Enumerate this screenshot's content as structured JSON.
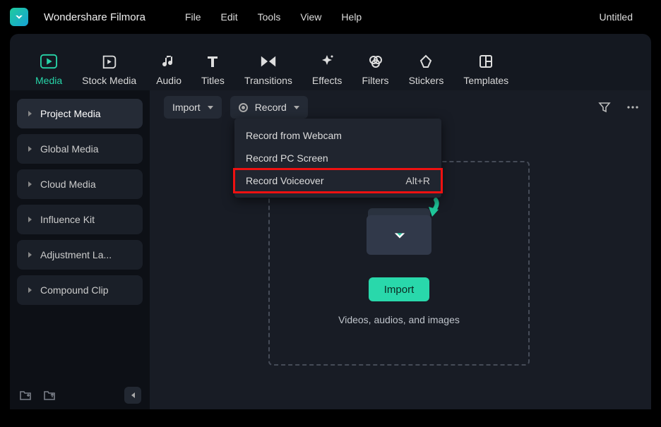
{
  "app_name": "Wondershare Filmora",
  "document_title": "Untitled",
  "menu": {
    "file": "File",
    "edit": "Edit",
    "tools": "Tools",
    "view": "View",
    "help": "Help"
  },
  "tabs": {
    "media": "Media",
    "stock_media": "Stock Media",
    "audio": "Audio",
    "titles": "Titles",
    "transitions": "Transitions",
    "effects": "Effects",
    "filters": "Filters",
    "stickers": "Stickers",
    "templates": "Templates"
  },
  "sidebar": {
    "items": [
      "Project Media",
      "Global Media",
      "Cloud Media",
      "Influence Kit",
      "Adjustment La...",
      "Compound Clip"
    ]
  },
  "actions": {
    "import_dropdown": "Import",
    "record_dropdown": "Record"
  },
  "record_menu": {
    "webcam": "Record from Webcam",
    "screen": "Record PC Screen",
    "voiceover": "Record Voiceover",
    "voiceover_shortcut": "Alt+R"
  },
  "dropzone": {
    "import_button": "Import",
    "hint": "Videos, audios, and images"
  }
}
